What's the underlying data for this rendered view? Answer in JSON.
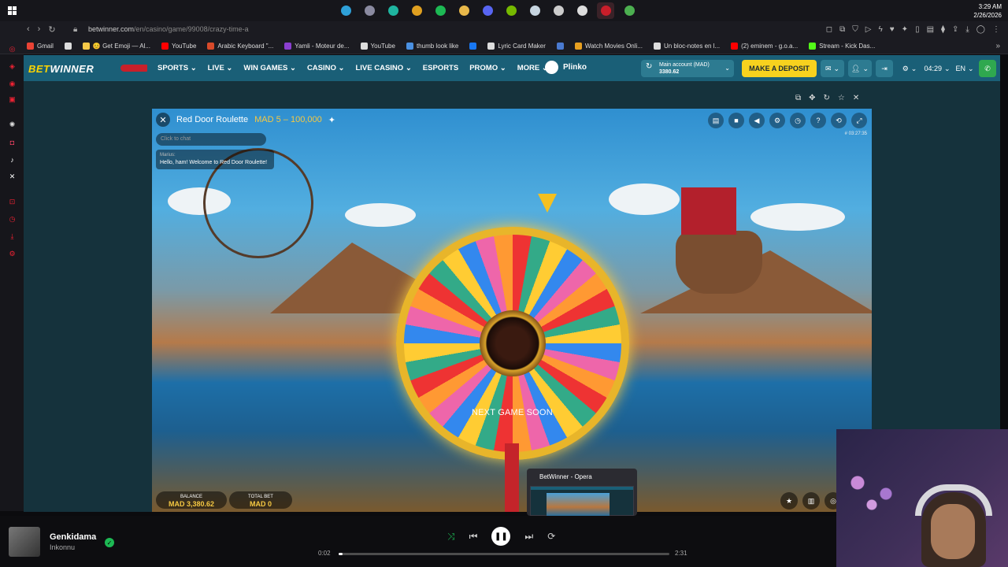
{
  "taskbar": {
    "apps": [
      {
        "icon": "edge-icon",
        "color": "#2ea0d8"
      },
      {
        "icon": "app-icon",
        "color": "#8a8aa0"
      },
      {
        "icon": "scan-icon",
        "color": "#1fb5a0"
      },
      {
        "icon": "chrome-icon",
        "color": "#e0a020"
      },
      {
        "icon": "spotify-icon",
        "color": "#1db954"
      },
      {
        "icon": "folder-icon",
        "color": "#e8b84a"
      },
      {
        "icon": "discord-icon",
        "color": "#5865f2"
      },
      {
        "icon": "nvidia-icon",
        "color": "#76b900"
      },
      {
        "icon": "steam-icon",
        "color": "#c7d5e0"
      },
      {
        "icon": "ai-icon",
        "color": "#cccccc"
      },
      {
        "icon": "obs-icon",
        "color": "#dddddd"
      },
      {
        "icon": "opera-icon",
        "color": "#c91e2a"
      },
      {
        "icon": "stats-icon",
        "color": "#4caf50"
      }
    ],
    "time": "3:29 AM",
    "date": "2/26/2026"
  },
  "browser": {
    "url_host": "betwinner.com",
    "url_path": "/en/casino/game/99008/crazy-time-a",
    "bookmarks": [
      {
        "label": "Gmail",
        "color": "#ea4335"
      },
      {
        "label": "",
        "color": "#dddddd"
      },
      {
        "label": "😊 Get Emoji — Al...",
        "color": "#f7c948"
      },
      {
        "label": "YouTube",
        "color": "#ff0000"
      },
      {
        "label": "Arabic Keyboard \"...",
        "color": "#d84a2a"
      },
      {
        "label": "Yamli - Moteur de...",
        "color": "#8b3fd0"
      },
      {
        "label": "YouTube",
        "color": "#dddddd"
      },
      {
        "label": "thumb look like",
        "color": "#4a90e2"
      },
      {
        "label": "",
        "color": "#1877f2"
      },
      {
        "label": "Lyric Card Maker",
        "color": "#dddddd"
      },
      {
        "label": "",
        "color": "#4a7ad0"
      },
      {
        "label": "Watch Movies Onli...",
        "color": "#e8a020"
      },
      {
        "label": "Un bloc-notes en l...",
        "color": "#dddddd"
      },
      {
        "label": "(2) eminem - g.o.a...",
        "color": "#ff0000"
      },
      {
        "label": "Stream - Kick Das...",
        "color": "#53fc18"
      }
    ]
  },
  "site": {
    "logo_bet": "BET",
    "logo_winner": "WINNER",
    "menu": [
      "SPORTS ⌄",
      "LIVE ⌄",
      "WIN GAMES ⌄",
      "CASINO ⌄",
      "LIVE CASINO ⌄",
      "ESPORTS",
      "PROMO ⌄",
      "MORE ⌄"
    ],
    "plinko": "Plinko",
    "account_label": "Main account (MAD)",
    "account_balance": "3380.62",
    "deposit": "MAKE A DEPOSIT",
    "time": "04:29",
    "lang": "EN"
  },
  "game": {
    "title": "Red Door Roulette",
    "limits": "MAD 5 – 100,000",
    "chat_placeholder": "Click to chat",
    "chat_user": "Marius:",
    "chat_text": "Hello, ham! Welcome to Red Door Roulette!",
    "stream_time": "# 03:27:35",
    "status": "NEXT GAME SOON",
    "balance_label": "BALANCE",
    "balance": "MAD 3,380.62",
    "total_bet_label": "TOTAL BET",
    "total_bet": "MAD 0"
  },
  "preview": {
    "title": "BetWinner - Opera"
  },
  "music": {
    "track": "Genkidama",
    "artist": "Inkonnu",
    "elapsed": "0:02",
    "total": "2:31",
    "progress_fraction": 0.013
  }
}
